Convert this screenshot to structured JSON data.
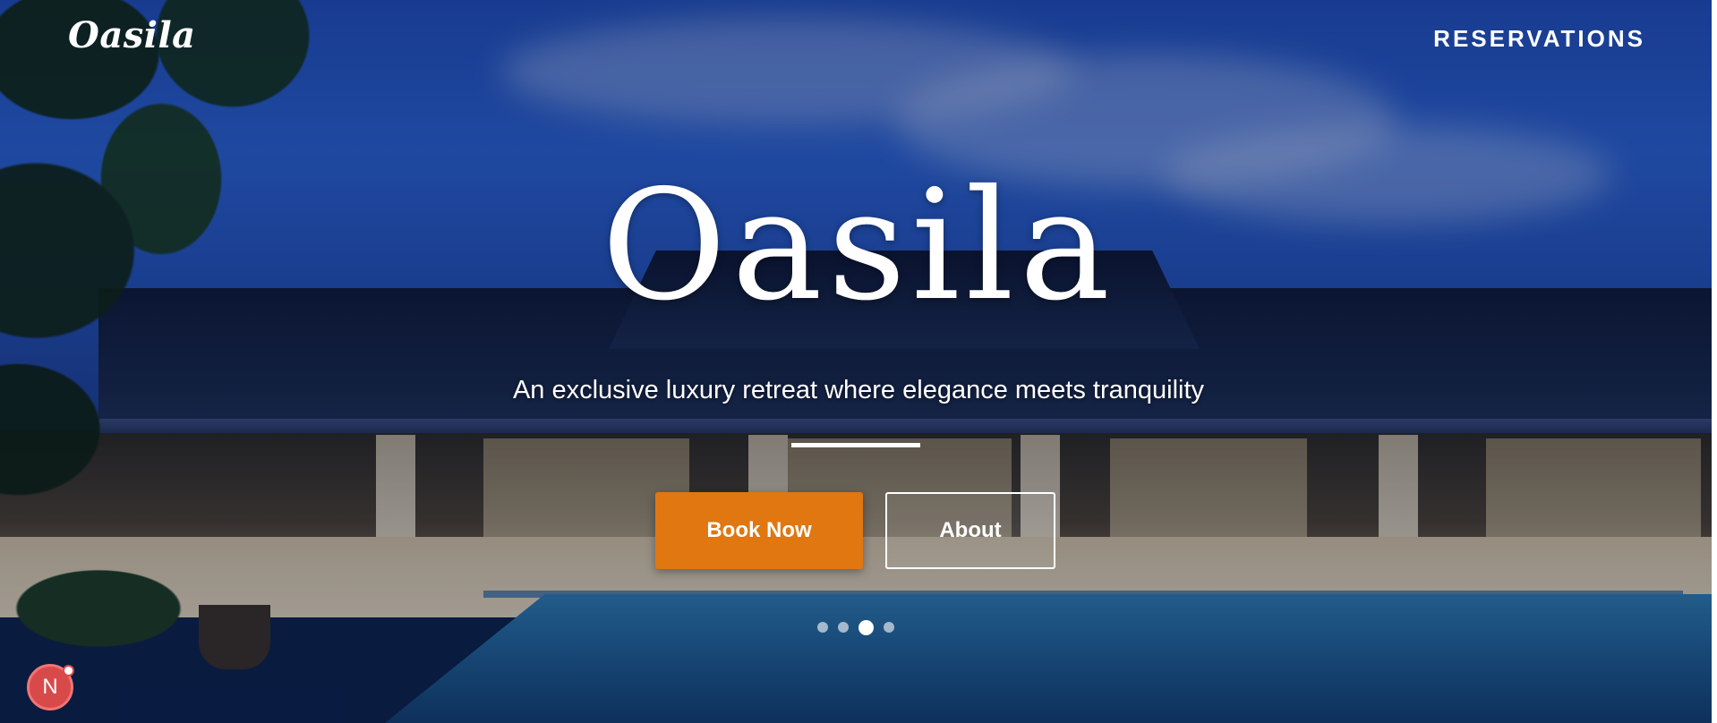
{
  "header": {
    "brand": "Oasila",
    "nav_reservations": "RESERVATIONS"
  },
  "hero": {
    "title": "Oasila",
    "subtitle": "An exclusive luxury retreat where elegance meets tranquility",
    "book_label": "Book Now",
    "about_label": "About"
  },
  "carousel": {
    "slide_count": 4,
    "active_index": 2
  },
  "badge": {
    "letter": "N"
  },
  "colors": {
    "accent": "#e07711",
    "text": "#ffffff",
    "sky": "#2a63d8",
    "badge": "#d84a4a"
  }
}
